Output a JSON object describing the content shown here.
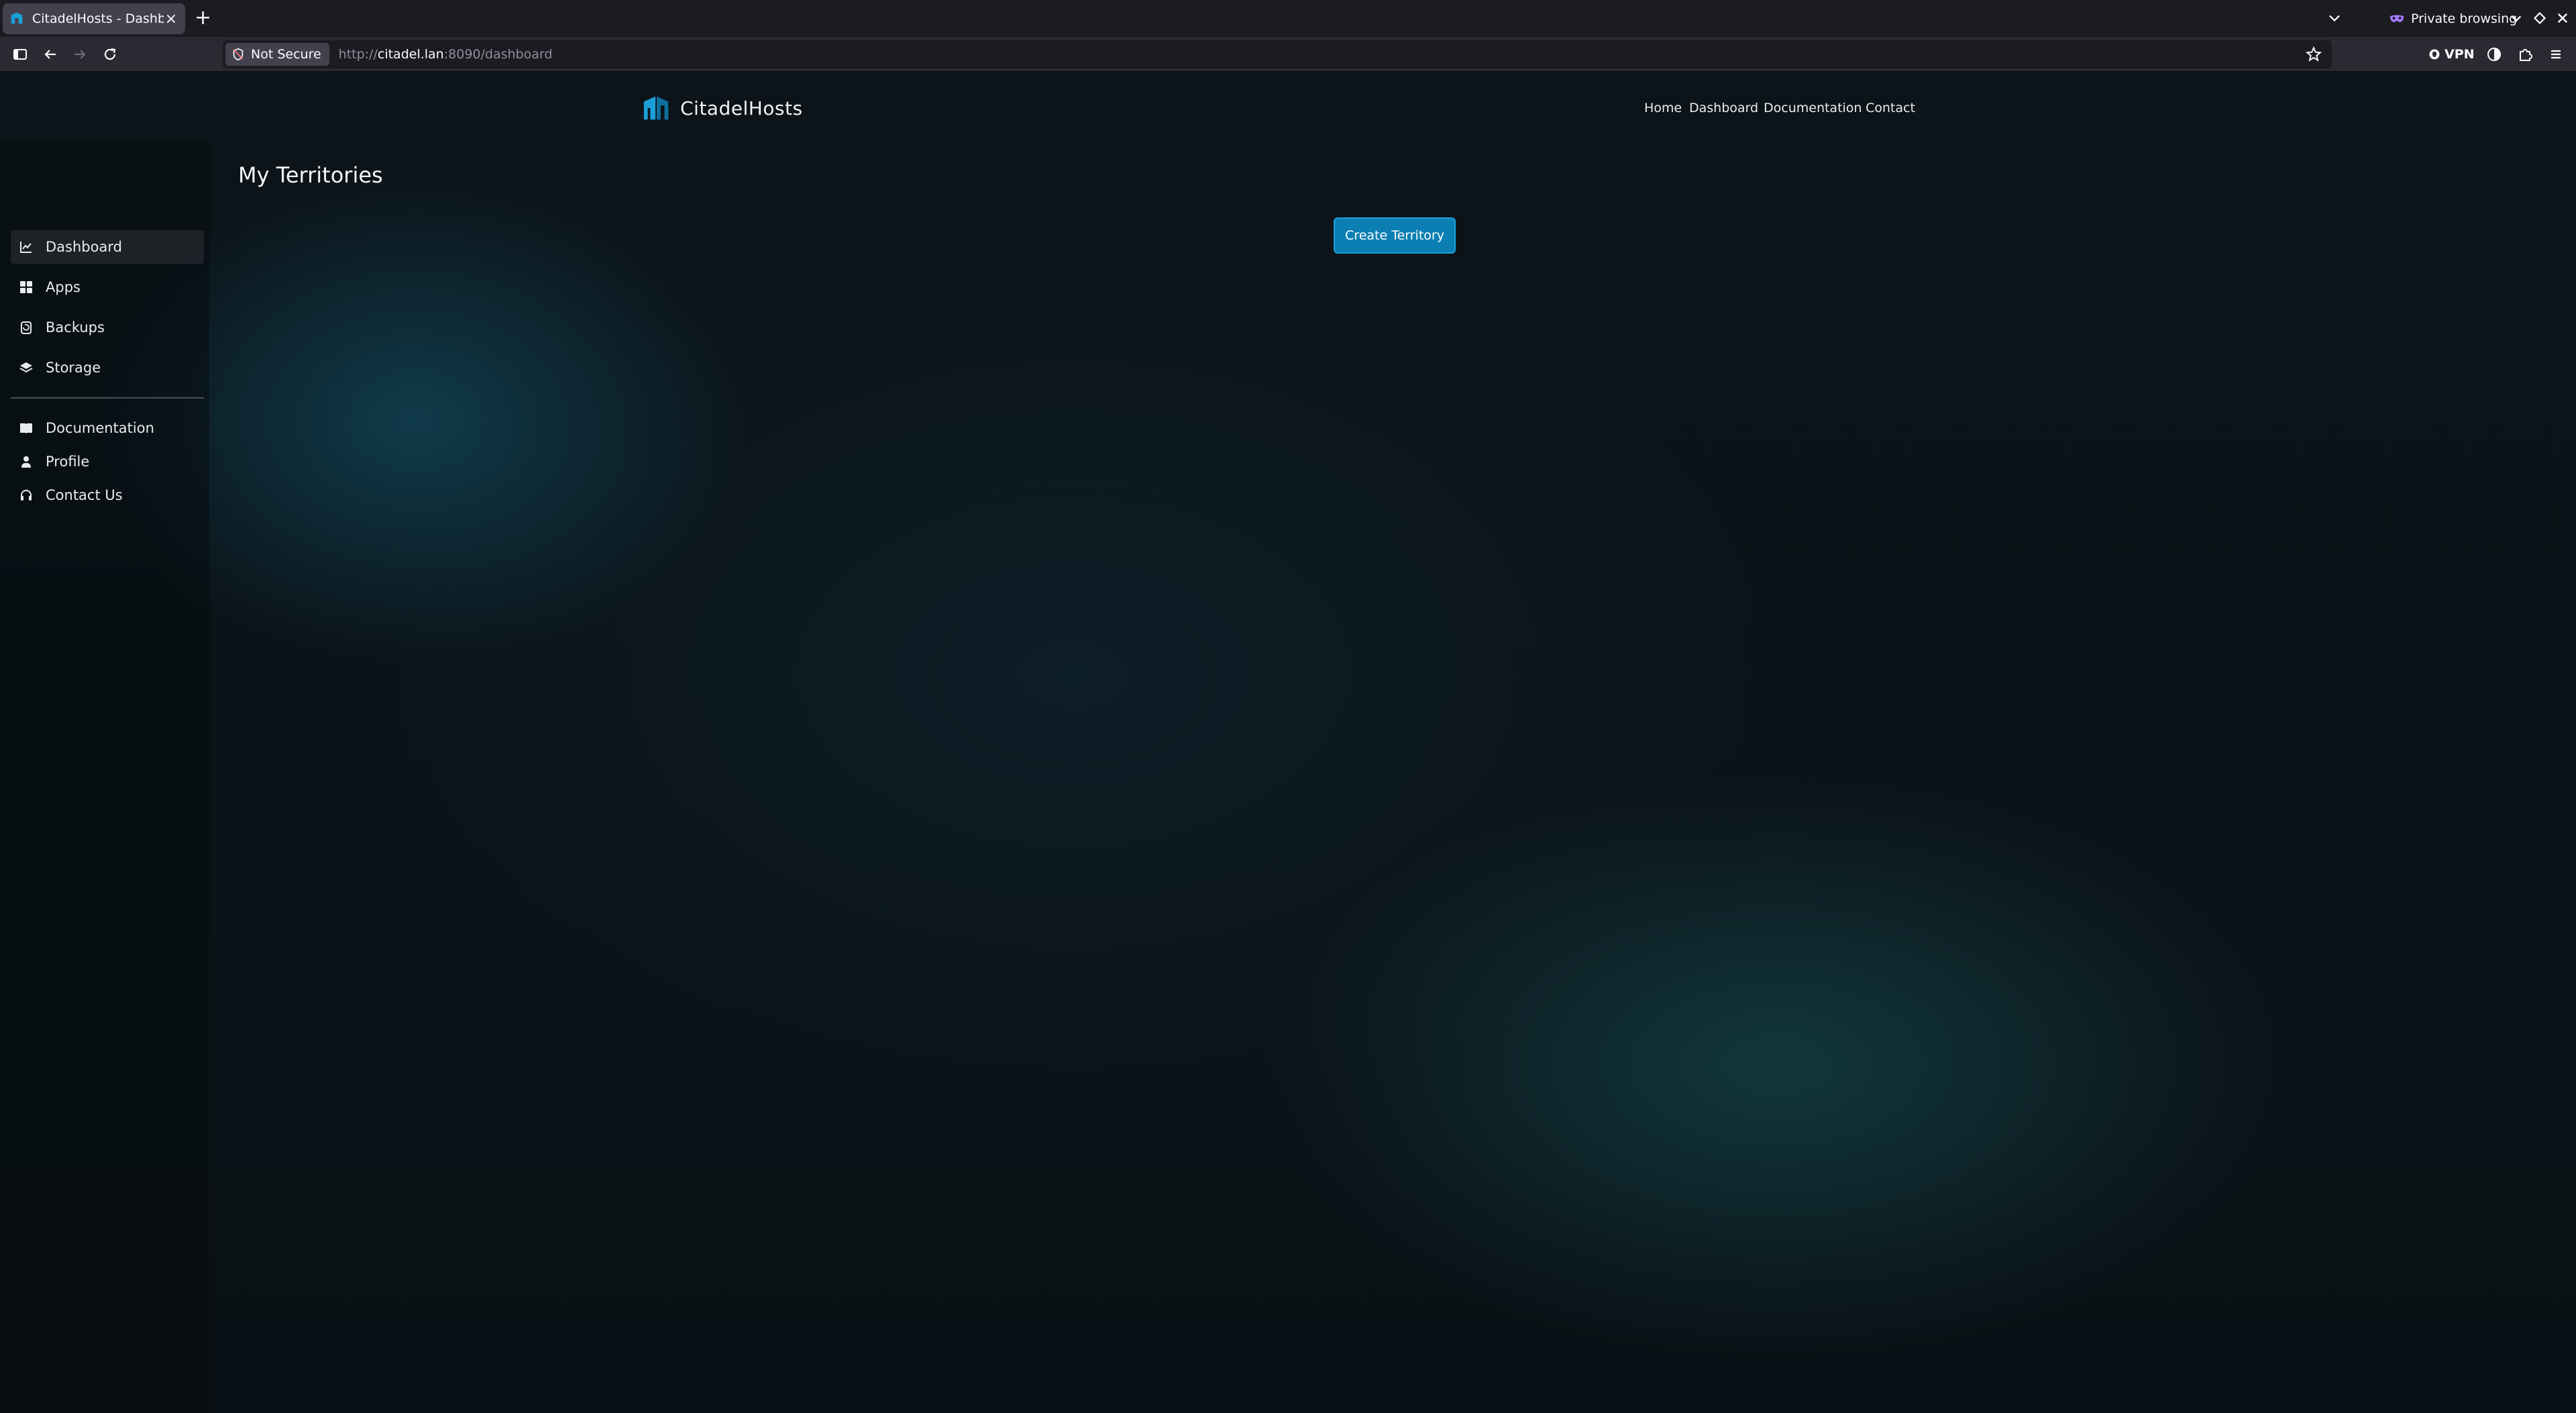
{
  "browser": {
    "tab_title": "CitadelHosts - Dashboard",
    "private_label": "Private browsing",
    "not_secure_label": "Not Secure",
    "url_prefix": "http://",
    "url_host": "citadel.lan",
    "url_rest": ":8090/dashboard",
    "vpn_label": "VPN"
  },
  "site": {
    "brand": "CitadelHosts",
    "brand_color": "#1aa0d8",
    "nav": [
      "Home",
      "Dashboard",
      "Documentation",
      "Contact"
    ]
  },
  "sidebar": {
    "primary": [
      {
        "label": "Dashboard",
        "icon": "chart-line-icon",
        "active": true
      },
      {
        "label": "Apps",
        "icon": "grid-icon",
        "active": false
      },
      {
        "label": "Backups",
        "icon": "backup-icon",
        "active": false
      },
      {
        "label": "Storage",
        "icon": "layers-icon",
        "active": false
      }
    ],
    "secondary": [
      {
        "label": "Documentation",
        "icon": "book-icon"
      },
      {
        "label": "Profile",
        "icon": "user-icon"
      },
      {
        "label": "Contact Us",
        "icon": "headset-icon"
      }
    ]
  },
  "main": {
    "title": "My Territories",
    "create_button": "Create Territory"
  }
}
